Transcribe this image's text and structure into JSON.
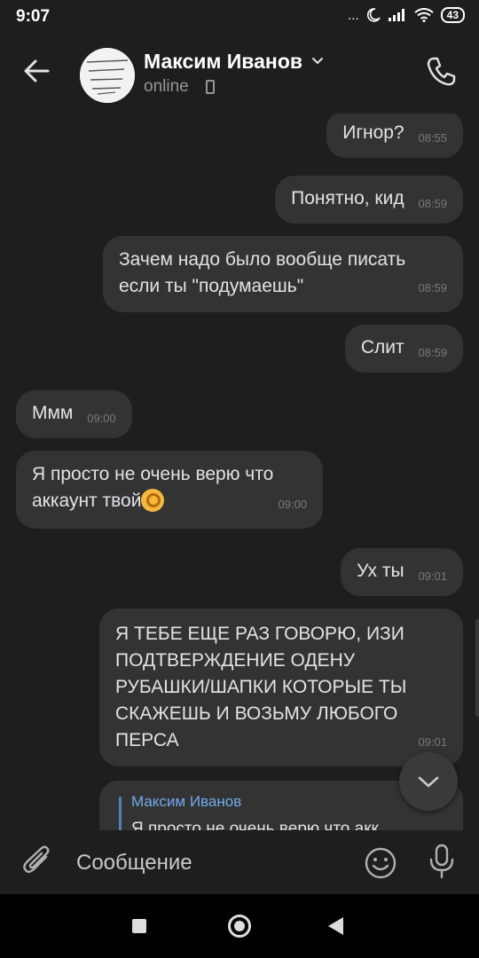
{
  "status_bar": {
    "time": "9:07",
    "battery": "43",
    "dots": "..."
  },
  "header": {
    "name": "Максим Иванов",
    "status": "online",
    "avatar_icon": "avatar-image"
  },
  "messages": [
    {
      "text": "Игнор?",
      "time": "08:55",
      "direction": "out"
    },
    {
      "text": "Понятно, кид",
      "time": "08:59",
      "direction": "out"
    },
    {
      "text_line1": "Зачем надо было вообще писать",
      "text_line2": "если ты \"подумаешь\"",
      "time": "08:59",
      "direction": "out"
    },
    {
      "text": "Слит",
      "time": "08:59",
      "direction": "out"
    },
    {
      "text": "Ммм",
      "time": "09:00",
      "direction": "in"
    },
    {
      "text_line1": "Я просто не очень верю что",
      "text_line2": "аккаунт твой",
      "emoji": "ok-hand",
      "time": "09:00",
      "direction": "in"
    },
    {
      "text": "Ух ты",
      "time": "09:01",
      "direction": "out"
    },
    {
      "lines": [
        "Я ТЕБЕ ЕЩЕ РАЗ ГОВОРЮ, ИЗИ",
        "ПОДТВЕРЖДЕНИЕ ОДЕНУ",
        "РУБАШКИ/ШАПКИ КОТОРЫЕ ТЫ",
        "СКАЖЕШЬ И ВОЗЬМУ ЛЮБОГО",
        "ПЕРСА"
      ],
      "time": "09:01",
      "direction": "out"
    }
  ],
  "reply": {
    "author": "Максим Иванов",
    "text": "Я просто не очень верю что акк"
  },
  "composer": {
    "placeholder": "Сообщение"
  },
  "colors": {
    "background": "#1e1e1e",
    "bubble": "#333333",
    "accent": "#71aaeb"
  }
}
